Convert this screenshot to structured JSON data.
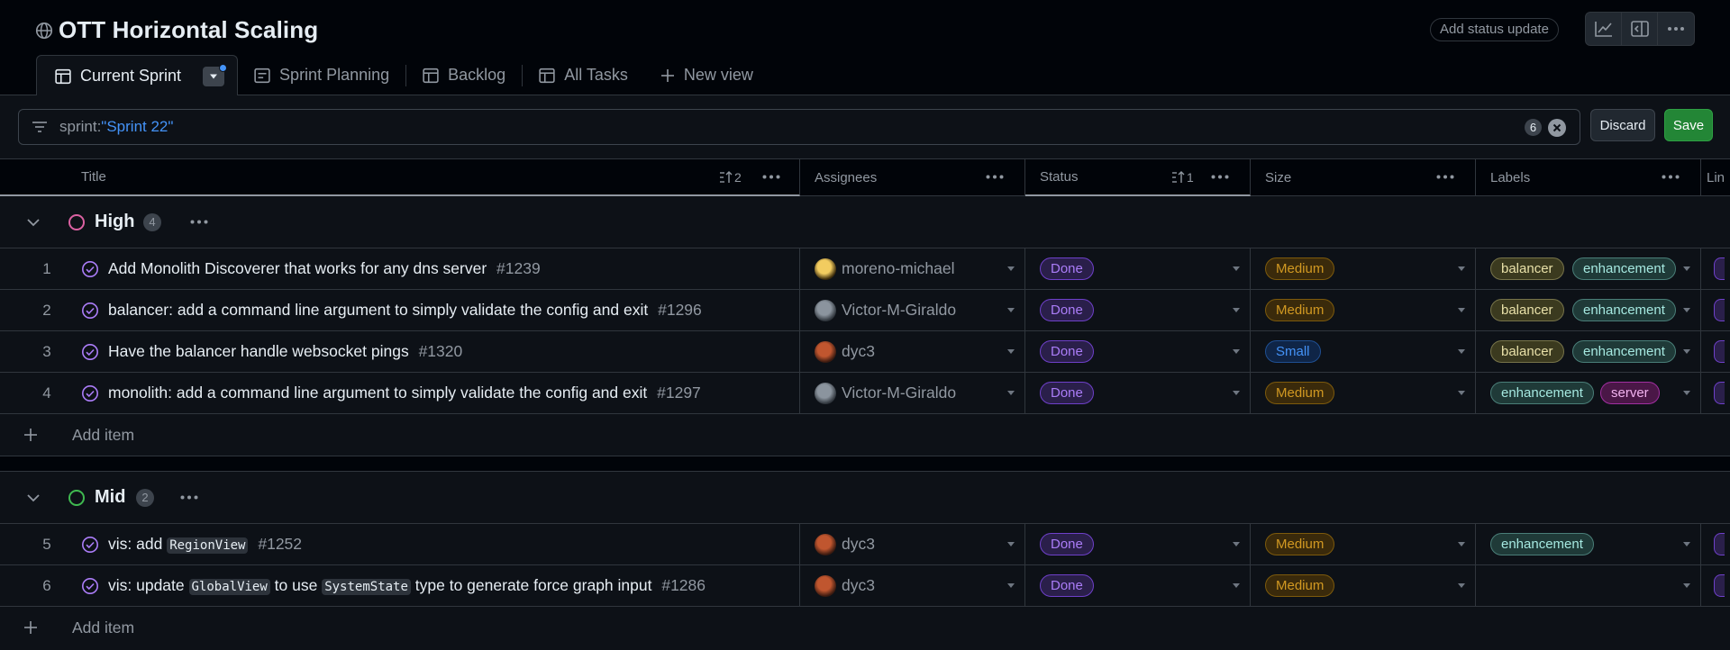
{
  "header": {
    "title": "OTT Horizontal Scaling",
    "status_update_label": "Add status update"
  },
  "tabs": [
    {
      "label": "Current Sprint",
      "icon": "table-icon",
      "active": true
    },
    {
      "label": "Sprint Planning",
      "icon": "board-icon"
    },
    {
      "label": "Backlog",
      "icon": "table-icon"
    },
    {
      "label": "All Tasks",
      "icon": "table-icon"
    },
    {
      "label": "New view",
      "icon": "plus-icon"
    }
  ],
  "filter": {
    "prefix": "sprint:",
    "value": "\"Sprint 22\"",
    "count": "6",
    "discard_label": "Discard",
    "save_label": "Save"
  },
  "columns": {
    "title": "Title",
    "title_sort": "2",
    "assignees": "Assignees",
    "status": "Status",
    "status_sort": "1",
    "size": "Size",
    "labels": "Labels",
    "last": "Lin"
  },
  "groups": [
    {
      "name": "High",
      "count": "4",
      "color": "#db61a2",
      "rows": [
        {
          "n": "1",
          "title": "Add Monolith Discoverer that works for any dns server",
          "num": "#1239",
          "assignee": "moreno-michael",
          "status": "Done",
          "size": "Medium",
          "labels": [
            "balancer",
            "enhancement"
          ]
        },
        {
          "n": "2",
          "title": "balancer: add a command line argument to simply validate the config and exit",
          "num": "#1296",
          "assignee": "Victor-M-Giraldo",
          "status": "Done",
          "size": "Medium",
          "labels": [
            "balancer",
            "enhancement"
          ]
        },
        {
          "n": "3",
          "title": "Have the balancer handle websocket pings",
          "num": "#1320",
          "assignee": "dyc3",
          "status": "Done",
          "size": "Small",
          "labels": [
            "balancer",
            "enhancement"
          ]
        },
        {
          "n": "4",
          "title": "monolith: add a command line argument to simply validate the config and exit",
          "num": "#1297",
          "assignee": "Victor-M-Giraldo",
          "status": "Done",
          "size": "Medium",
          "labels": [
            "enhancement",
            "server"
          ]
        }
      ],
      "add_label": "Add item"
    },
    {
      "name": "Mid",
      "count": "2",
      "color": "#3fb950",
      "rows": [
        {
          "n": "5",
          "title_parts": [
            "vis: add ",
            "RegionView",
            ""
          ],
          "num": "#1252",
          "assignee": "dyc3",
          "status": "Done",
          "size": "Medium",
          "labels": [
            "enhancement"
          ]
        },
        {
          "n": "6",
          "title_parts": [
            "vis: update ",
            "GlobalView",
            " to use ",
            "SystemState",
            " type to generate force graph input"
          ],
          "num": "#1286",
          "assignee": "dyc3",
          "status": "Done",
          "size": "Medium",
          "labels": []
        }
      ],
      "add_label": "Add item"
    }
  ]
}
